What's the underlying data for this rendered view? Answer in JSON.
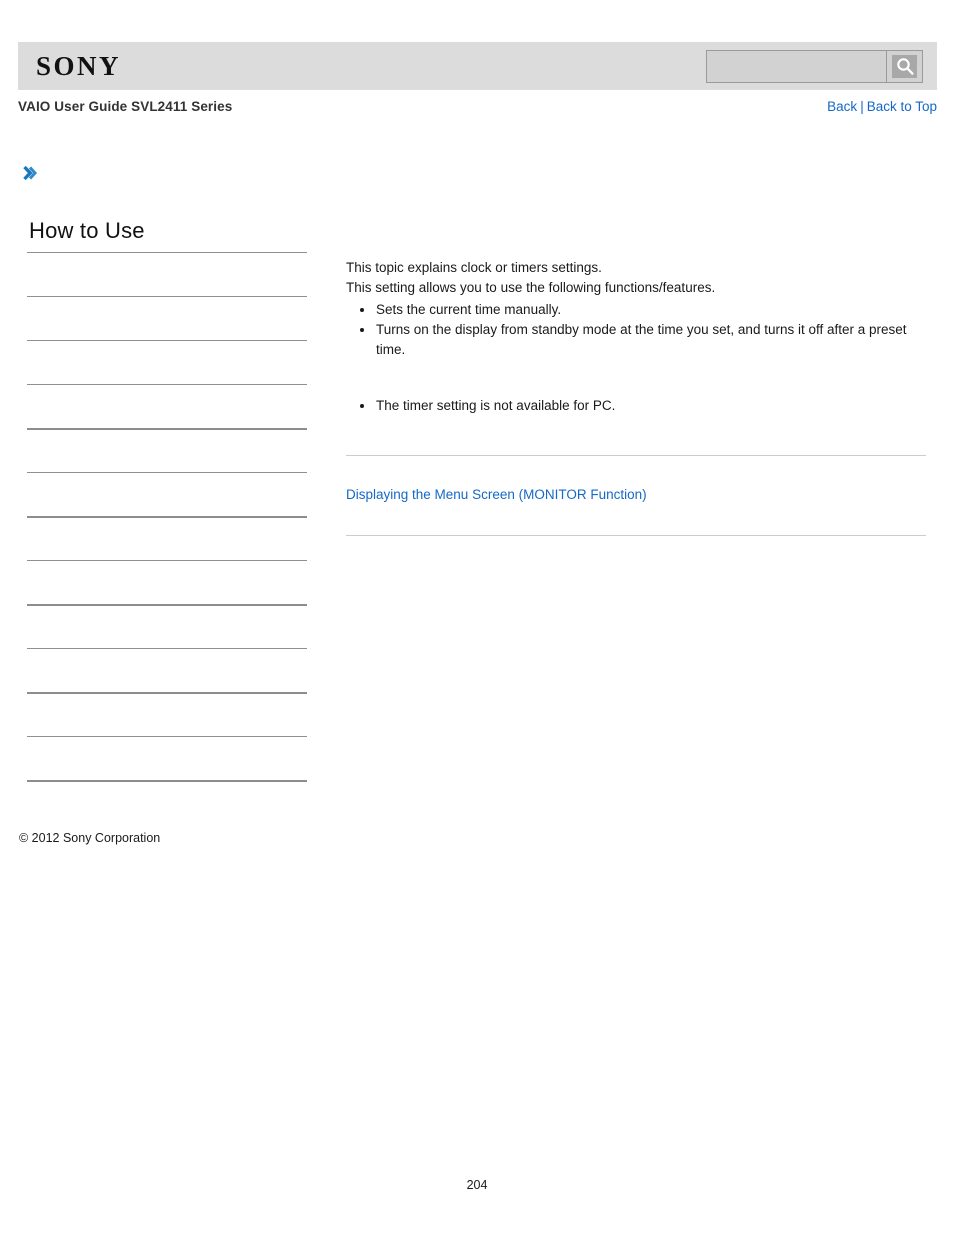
{
  "header": {
    "logo_text": "SONY",
    "search": {
      "value": "",
      "placeholder": "",
      "button_icon": "search-icon"
    }
  },
  "subheader": {
    "guide_title": "VAIO User Guide SVL2411 Series",
    "links": {
      "back": "Back",
      "separator": "|",
      "back_to_top": "Back to Top"
    }
  },
  "breadcrumb": {
    "icon": "double-chevron-right-icon",
    "text": ""
  },
  "sidebar": {
    "title": "How to Use",
    "items": [
      {
        "label": "",
        "group_end": false
      },
      {
        "label": "",
        "group_end": false
      },
      {
        "label": "",
        "group_end": false
      },
      {
        "label": "",
        "group_end": false
      },
      {
        "label": "",
        "group_end": true
      },
      {
        "label": "",
        "group_end": false
      },
      {
        "label": "",
        "group_end": true
      },
      {
        "label": "",
        "group_end": false
      },
      {
        "label": "",
        "group_end": true
      },
      {
        "label": "",
        "group_end": false
      },
      {
        "label": "",
        "group_end": true
      },
      {
        "label": "",
        "group_end": false
      },
      {
        "label": "",
        "group_end": true
      }
    ],
    "copyright": "© 2012 Sony Corporation"
  },
  "content": {
    "intro_line_1": "This topic explains clock or timers settings.",
    "intro_line_2": "This setting allows you to use the following functions/features.",
    "feature_bullets": [
      "Sets the current time manually.",
      "Turns on the display from standby mode at the time you set, and turns it off after a preset time."
    ],
    "note_bullets": [
      "The timer setting is not available for PC."
    ],
    "related_link": "Displaying the Menu Screen (MONITOR Function)"
  },
  "footer": {
    "page_number": "204"
  },
  "colors": {
    "link": "#1569c7",
    "header_band": "#dcdcdc",
    "rule": "#cccccc",
    "sidebar_rule": "#8f8f8f"
  }
}
